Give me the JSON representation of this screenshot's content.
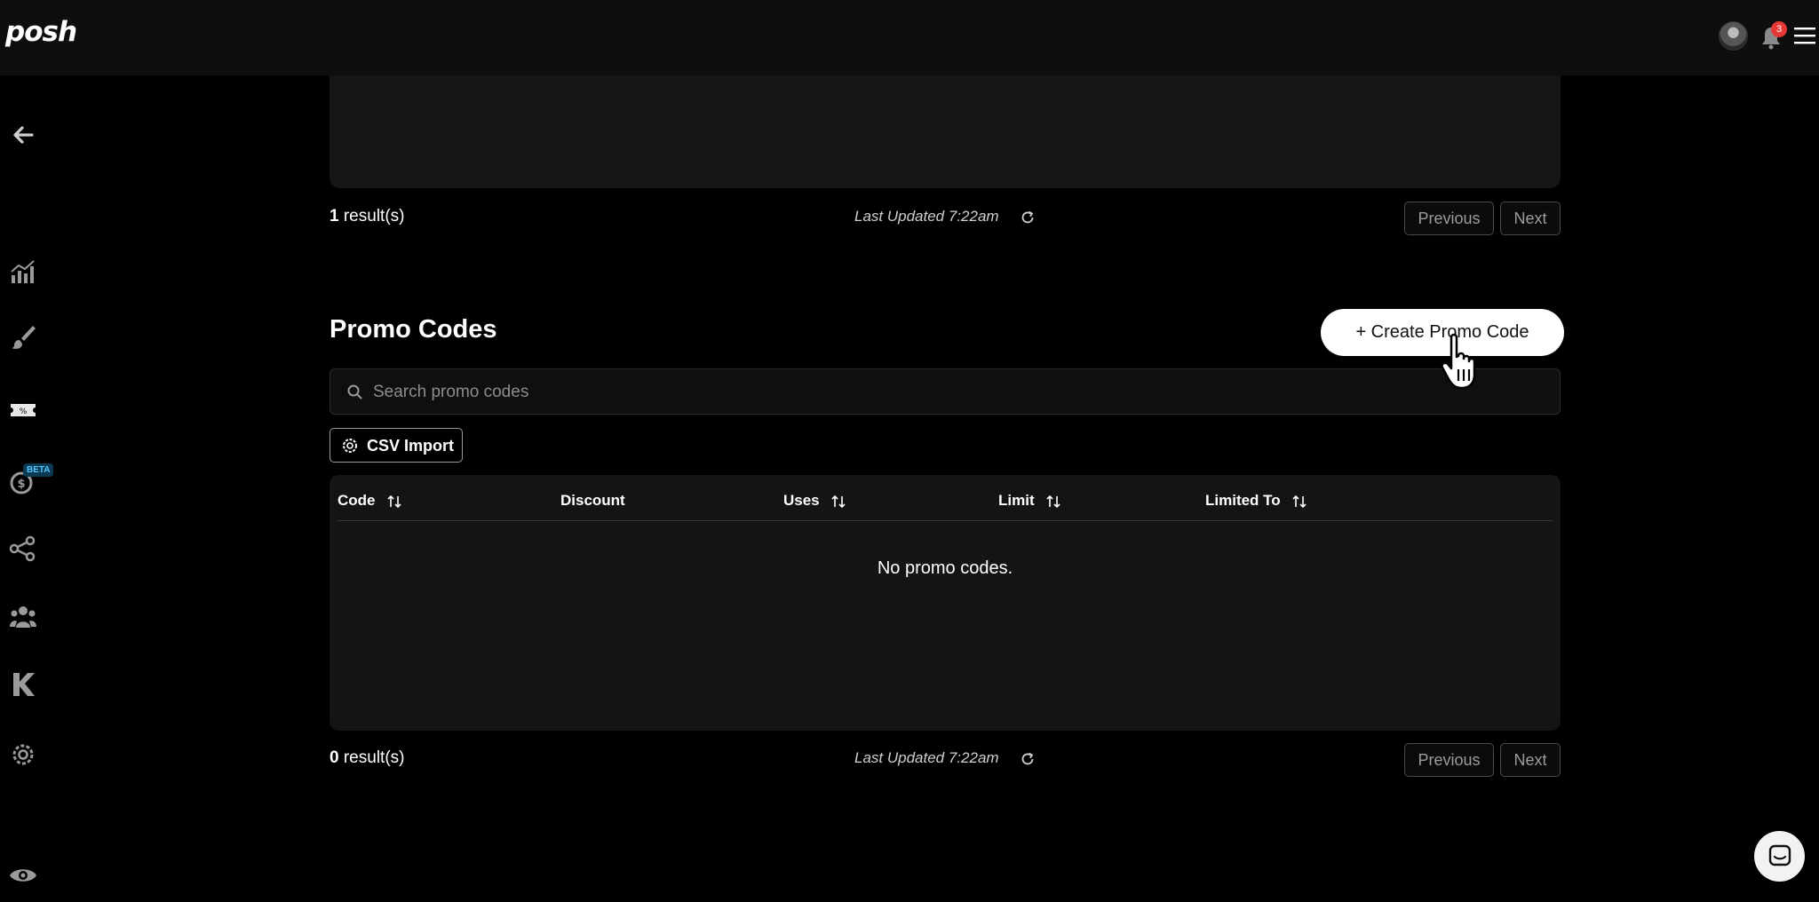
{
  "app": {
    "logo_text": "posh"
  },
  "header": {
    "notification_count": "3"
  },
  "sidebar": {
    "items": [
      {
        "icon": "back-arrow-icon"
      },
      {
        "icon": "analytics-icon"
      },
      {
        "icon": "paintbrush-icon"
      },
      {
        "icon": "ticket-icon"
      },
      {
        "icon": "money-icon",
        "badge": "BETA"
      },
      {
        "icon": "share-icon"
      },
      {
        "icon": "team-icon"
      },
      {
        "icon": "k-logo-icon"
      },
      {
        "icon": "gear-icon"
      },
      {
        "icon": "eye-icon"
      }
    ]
  },
  "top_section": {
    "result_count": "1",
    "result_suffix": " result(s)",
    "last_updated": "Last Updated 7:22am",
    "prev_label": "Previous",
    "next_label": "Next"
  },
  "promo": {
    "title": "Promo Codes",
    "create_label": "+ Create Promo Code",
    "search_placeholder": "Search promo codes",
    "csv_import_label": "CSV Import",
    "columns": [
      "Code",
      "Discount",
      "Uses",
      "Limit",
      "Limited To"
    ],
    "empty_message": "No promo codes.",
    "result_count": "0",
    "result_suffix": " result(s)",
    "last_updated": "Last Updated 7:22am",
    "prev_label": "Previous",
    "next_label": "Next"
  },
  "colors": {
    "background": "#000000",
    "panel": "#161616",
    "notification_badge": "#e53935",
    "beta_badge": "#52c6ff"
  }
}
